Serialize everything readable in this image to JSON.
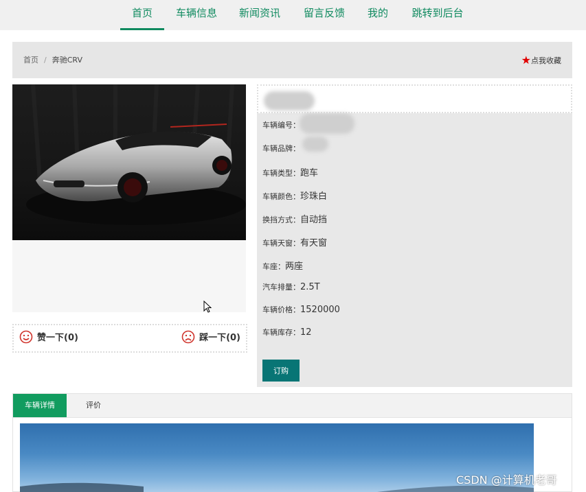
{
  "nav": {
    "items": [
      {
        "label": "首页",
        "active": true
      },
      {
        "label": "车辆信息",
        "active": false
      },
      {
        "label": "新闻资讯",
        "active": false
      },
      {
        "label": "留言反馈",
        "active": false
      },
      {
        "label": "我的",
        "active": false
      },
      {
        "label": "跳转到后台",
        "active": false
      }
    ]
  },
  "breadcrumb": {
    "home": "首页",
    "separator": "/",
    "current": "奔驰CRV"
  },
  "favorite": {
    "label": "点我收藏",
    "icon": "star-icon",
    "color": "#e00000"
  },
  "vote": {
    "like_label": "赞一下(0)",
    "like_icon": "smile-icon",
    "dislike_label": "踩一下(0)",
    "dislike_icon": "frown-icon"
  },
  "details": {
    "rows": [
      {
        "label": "车辆编号：",
        "value": ""
      },
      {
        "label": "车辆品牌：",
        "value": ""
      },
      {
        "label": "车辆类型：",
        "value": "跑车"
      },
      {
        "label": "车辆颜色：",
        "value": "珍珠白"
      },
      {
        "label": "换挡方式：",
        "value": "自动挡"
      },
      {
        "label": "车辆天窗：",
        "value": "有天窗"
      },
      {
        "label": "车座：",
        "value": "两座"
      },
      {
        "label": "汽车排量：",
        "value": "2.5T"
      },
      {
        "label": "车辆价格：",
        "value": "1520000"
      },
      {
        "label": "车辆库存：",
        "value": "12"
      }
    ],
    "order_button": "订购"
  },
  "tabs": [
    {
      "label": "车辆详情",
      "active": true
    },
    {
      "label": "评价",
      "active": false
    }
  ],
  "watermark": "CSDN @计算机老哥",
  "colors": {
    "accent": "#0f8a5f",
    "tab_active": "#119c5f",
    "button": "#087575"
  }
}
